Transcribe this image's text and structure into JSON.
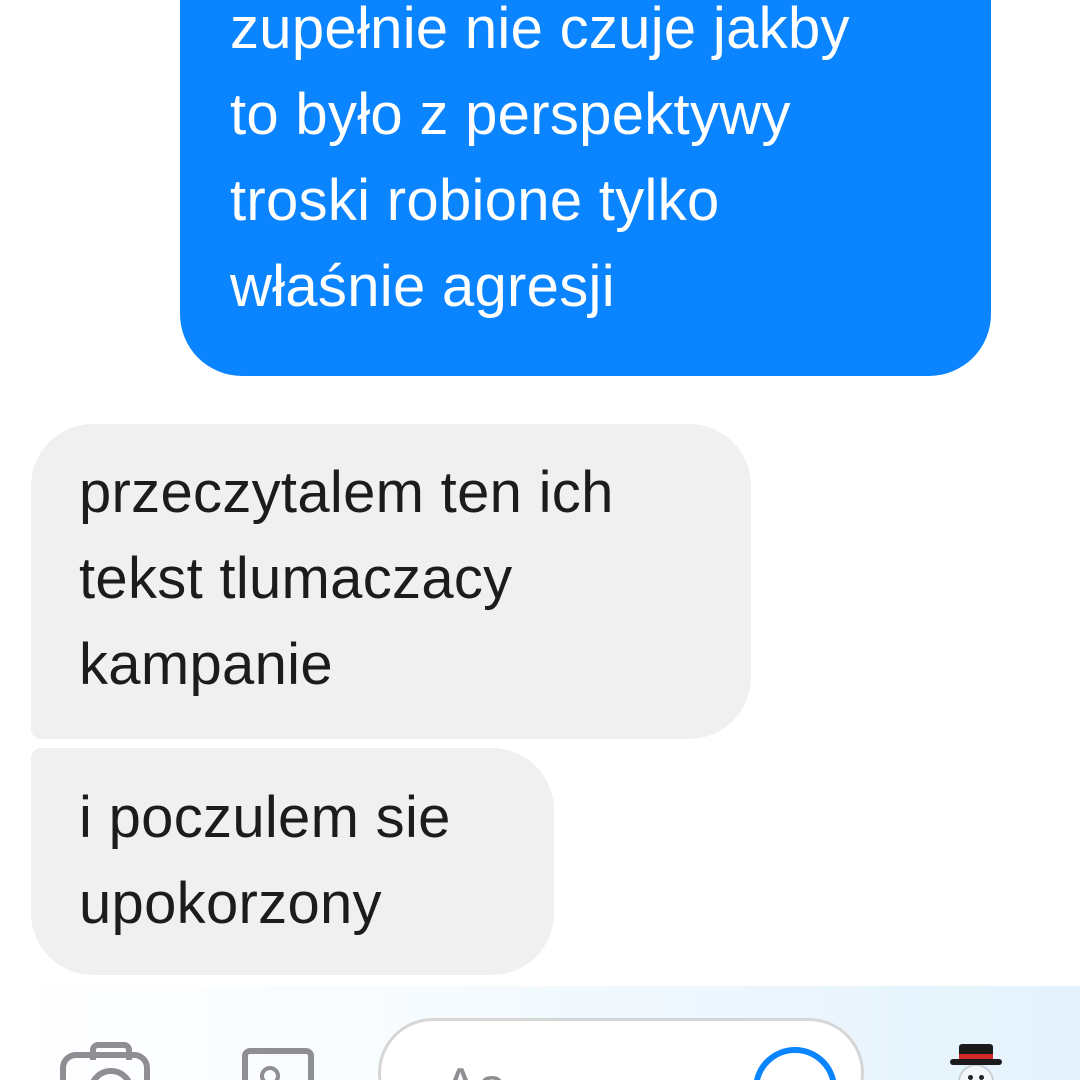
{
  "conversation": {
    "outgoing_message": {
      "lines": [
        "zupełnie nie czuje jakby",
        "to było z perspektywy",
        "troski robione tylko",
        "właśnie agresji"
      ]
    },
    "incoming_messages": [
      {
        "lines": [
          "przeczytalem ten ich",
          "tekst tlumaczacy",
          "kampanie"
        ]
      },
      {
        "lines": [
          "i poczulem sie",
          "upokorzony"
        ]
      }
    ]
  },
  "composer": {
    "placeholder": "Aa",
    "icons": [
      "camera-icon",
      "photo-icon",
      "emoji-icon",
      "snowman-icon"
    ],
    "accent_color": "#0a84ff",
    "icon_color": "#8e8e93"
  },
  "colors": {
    "outgoing_bubble": "#0a84ff",
    "incoming_bubble": "#f0f0f0",
    "incoming_text": "#1c1c1c",
    "outgoing_text": "#ffffff",
    "background": "#ffffff"
  }
}
